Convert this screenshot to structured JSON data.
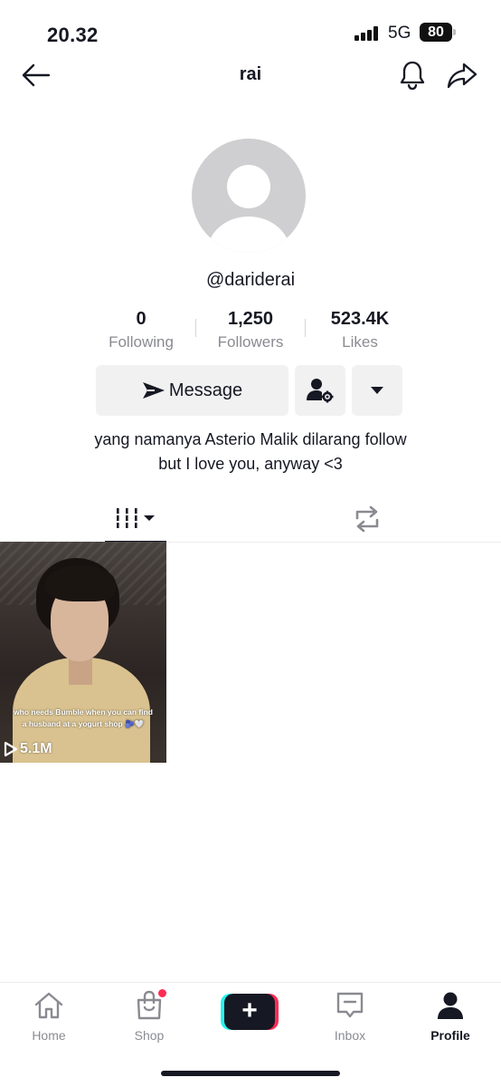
{
  "status_bar": {
    "time": "20.32",
    "network": "5G",
    "battery": "80"
  },
  "header": {
    "title": "rai",
    "back_icon": "arrow-left-icon",
    "notification_icon": "bell-icon",
    "share_icon": "share-arrow-icon"
  },
  "profile": {
    "username": "@dariderai",
    "stats": [
      {
        "value": "0",
        "label": "Following"
      },
      {
        "value": "1,250",
        "label": "Followers"
      },
      {
        "value": "523.4K",
        "label": "Likes"
      }
    ],
    "message_label": "Message",
    "bio_line1": "yang namanya Asterio Malik dilarang follow",
    "bio_line2": "but I love you, anyway <3"
  },
  "tabs": {
    "videos_icon": "grid-bars-icon",
    "reposts_icon": "repost-icon"
  },
  "videos": [
    {
      "caption": "who needs Bumble when you can find a husband at a yogurt shop 🫐🤍",
      "views": "5.1M"
    }
  ],
  "bottom_nav": [
    {
      "label": "Home",
      "icon": "home-icon"
    },
    {
      "label": "Shop",
      "icon": "shopping-bag-icon"
    },
    {
      "label": "",
      "icon": "plus-icon"
    },
    {
      "label": "Inbox",
      "icon": "inbox-icon"
    },
    {
      "label": "Profile",
      "icon": "profile-icon"
    }
  ],
  "colors": {
    "accent_pink": "#fe2c55",
    "accent_cyan": "#25f4ee",
    "text_primary": "#161823",
    "text_secondary": "#8a8b91"
  }
}
